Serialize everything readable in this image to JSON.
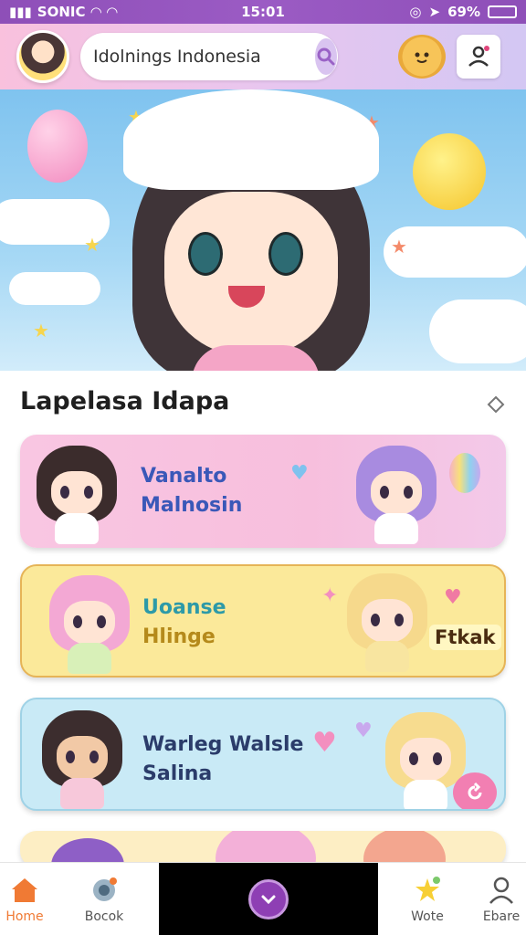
{
  "status_bar": {
    "carrier": "SONIC",
    "time": "15:01",
    "battery": "69%"
  },
  "header": {
    "search": {
      "value": "Idolnings Indonesia",
      "placeholder": "Search"
    },
    "icons": {
      "search": "search-icon",
      "cookie": "cookie-icon",
      "profile": "profile-icon"
    }
  },
  "hero": {
    "play_icon": "play-icon"
  },
  "section": {
    "title": "Lapelasa Idapa"
  },
  "cards": [
    {
      "line1": "Vanalto",
      "line2": "Malnosin",
      "badge": "",
      "color": "#f9c6e2"
    },
    {
      "line1": "Uoanse",
      "line2": "Hlinge",
      "badge": "Ftkak",
      "color": "#fbe99a"
    },
    {
      "line1": "Warleg Walsle",
      "line2": "Salina",
      "badge": "",
      "color": "#c9eaf6"
    }
  ],
  "nav": {
    "items": [
      {
        "label": "Home",
        "icon": "home-icon"
      },
      {
        "label": "Bocok",
        "icon": "headset-icon"
      },
      {
        "label": "Wote",
        "icon": "star-wand-icon"
      },
      {
        "label": "Ebare",
        "icon": "user-icon"
      }
    ],
    "center_icon": "chevron-down-icon"
  },
  "colors": {
    "accent": "#f07a34",
    "status_bar": "#9b5bc4",
    "fab": "#8e3fb4"
  }
}
